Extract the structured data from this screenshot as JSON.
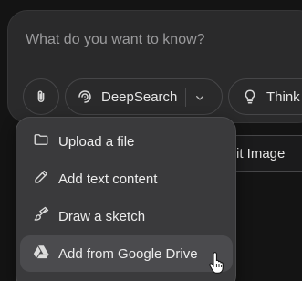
{
  "composer": {
    "placeholder": "What do you want to know?",
    "deepsearch_label": "DeepSearch",
    "think_label": "Think"
  },
  "background_chip": {
    "label": "it Image"
  },
  "attach_menu": {
    "items": [
      {
        "label": "Upload a file",
        "icon": "folder-icon"
      },
      {
        "label": "Add text content",
        "icon": "pencil-icon"
      },
      {
        "label": "Draw a sketch",
        "icon": "brush-icon"
      },
      {
        "label": "Add from Google Drive",
        "icon": "google-drive-icon",
        "hovered": true
      }
    ]
  },
  "colors": {
    "background": "#141414",
    "composer": "#2a2a2b",
    "menu": "#3a3a3c",
    "menu_hover": "#4b4b4e"
  }
}
